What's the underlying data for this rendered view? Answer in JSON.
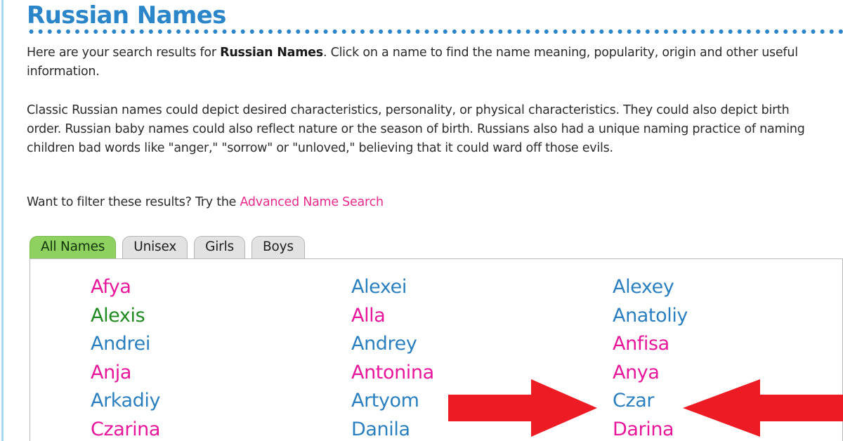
{
  "page": {
    "title": "Russian Names",
    "accent_blue": "#2a86c8",
    "link_pink": "#e72a8a",
    "girl_color": "#e6179b",
    "boy_color": "#2a80be",
    "unisex_color": "#1f8a1f",
    "tab_active_color": "#8fd160",
    "arrow_color": "#ed1c24"
  },
  "intro": {
    "before_bold": "Here are your search results for ",
    "bold": "Russian Names",
    "after_bold": ". Click on a name to find the name meaning, popularity, origin and other useful information."
  },
  "about": {
    "text": "Classic Russian names could depict desired characteristics, personality, or physical characteristics. They could also depict birth order. Russian baby names could also reflect nature or the season of birth. Russians also had a unique naming practice of naming children bad words like \"anger,\" \"sorrow\" or \"unloved,\" believing that it could ward off those evils."
  },
  "filter": {
    "prompt": "Want to filter these results? Try the ",
    "link_label": "Advanced Name Search"
  },
  "tabs": [
    {
      "label": "All Names",
      "active": true
    },
    {
      "label": "Unisex",
      "active": false
    },
    {
      "label": "Girls",
      "active": false
    },
    {
      "label": "Boys",
      "active": false
    }
  ],
  "names": {
    "columns": [
      [
        {
          "name": "Afya",
          "gender": "girl"
        },
        {
          "name": "Alexis",
          "gender": "unisex"
        },
        {
          "name": "Andrei",
          "gender": "boy"
        },
        {
          "name": "Anja",
          "gender": "girl"
        },
        {
          "name": "Arkadiy",
          "gender": "boy"
        },
        {
          "name": "Czarina",
          "gender": "girl"
        }
      ],
      [
        {
          "name": "Alexei",
          "gender": "boy"
        },
        {
          "name": "Alla",
          "gender": "girl"
        },
        {
          "name": "Andrey",
          "gender": "boy"
        },
        {
          "name": "Antonina",
          "gender": "girl"
        },
        {
          "name": "Artyom",
          "gender": "boy"
        },
        {
          "name": "Danila",
          "gender": "boy"
        }
      ],
      [
        {
          "name": "Alexey",
          "gender": "boy"
        },
        {
          "name": "Anatoliy",
          "gender": "boy"
        },
        {
          "name": "Anfisa",
          "gender": "girl"
        },
        {
          "name": "Anya",
          "gender": "girl"
        },
        {
          "name": "Czar",
          "gender": "boy"
        },
        {
          "name": "Darina",
          "gender": "girl"
        }
      ]
    ]
  },
  "annotations": [
    {
      "icon": "arrow-right-icon",
      "points_to": "Czar"
    },
    {
      "icon": "arrow-left-icon",
      "points_to": "Czar"
    }
  ]
}
